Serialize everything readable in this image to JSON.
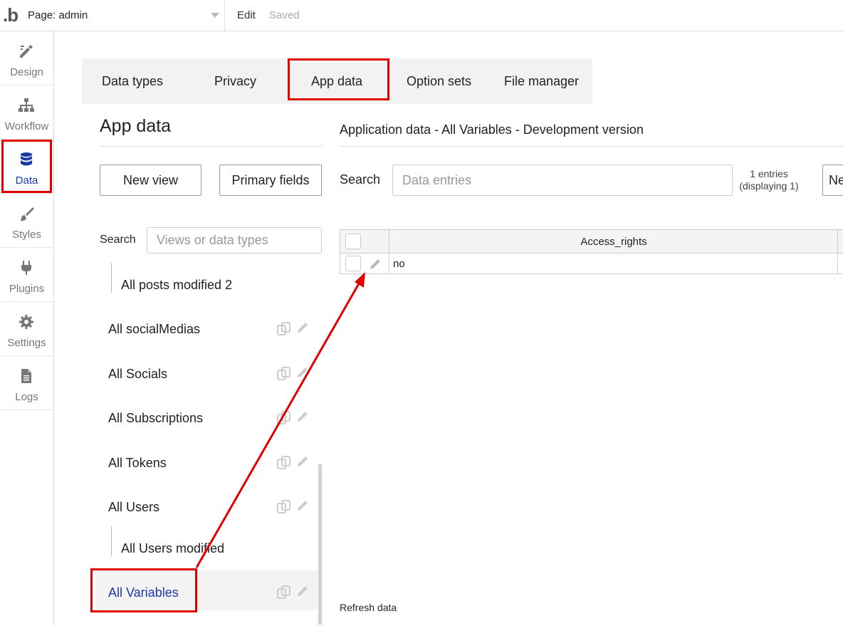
{
  "topbar": {
    "logo": ".b",
    "page_selector": "Page: admin",
    "edit": "Edit",
    "saved": "Saved"
  },
  "sidebar": {
    "items": [
      {
        "label": "Design",
        "icon": "design-icon"
      },
      {
        "label": "Workflow",
        "icon": "workflow-icon"
      },
      {
        "label": "Data",
        "icon": "database-icon",
        "active": true
      },
      {
        "label": "Styles",
        "icon": "brush-icon"
      },
      {
        "label": "Plugins",
        "icon": "plug-icon"
      },
      {
        "label": "Settings",
        "icon": "gear-icon"
      },
      {
        "label": "Logs",
        "icon": "document-icon"
      }
    ]
  },
  "tabs": [
    "Data types",
    "Privacy",
    "App data",
    "Option sets",
    "File manager"
  ],
  "left_panel": {
    "title": "App data",
    "new_view": "New view",
    "primary_fields": "Primary fields",
    "search_label": "Search",
    "search_placeholder": "Views or data types",
    "items": [
      {
        "label": "All posts modified 2",
        "sub": true
      },
      {
        "label": "All socialMedias"
      },
      {
        "label": "All Socials"
      },
      {
        "label": "All Subscriptions"
      },
      {
        "label": "All Tokens"
      },
      {
        "label": "All Users"
      },
      {
        "label": "All Users modified",
        "sub": true
      },
      {
        "label": "All Variables",
        "selected": true
      }
    ]
  },
  "right_panel": {
    "header": "Application data - All Variables - Development version",
    "search_label": "Search",
    "search_placeholder": "Data entries",
    "entries_line1": "1 entries",
    "entries_line2": "(displaying 1)",
    "new_button": "Ne",
    "table": {
      "columns": [
        "Access_rights"
      ],
      "rows": [
        [
          "no"
        ]
      ]
    },
    "refresh": "Refresh data"
  },
  "colors": {
    "accent": "#1a3aa8",
    "annotation": "#e00000"
  }
}
